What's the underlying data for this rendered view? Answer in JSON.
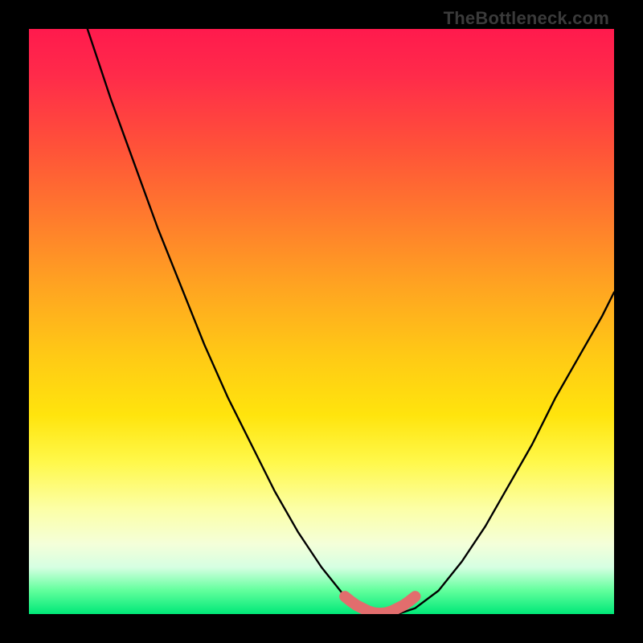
{
  "watermark": "TheBottleneck.com",
  "chart_data": {
    "type": "line",
    "title": "",
    "xlabel": "",
    "ylabel": "",
    "xlim": [
      0,
      100
    ],
    "ylim": [
      0,
      100
    ],
    "grid": false,
    "series": [
      {
        "name": "bottleneck-curve",
        "x": [
          10,
          14,
          18,
          22,
          26,
          30,
          34,
          38,
          42,
          46,
          50,
          54,
          57,
          59,
          61,
          63,
          66,
          70,
          74,
          78,
          82,
          86,
          90,
          94,
          98,
          100
        ],
        "values": [
          100,
          88,
          77,
          66,
          56,
          46,
          37,
          29,
          21,
          14,
          8,
          3,
          1,
          0,
          0,
          0,
          1,
          4,
          9,
          15,
          22,
          29,
          37,
          44,
          51,
          55
        ]
      }
    ],
    "highlight": {
      "name": "optimal-range",
      "x": [
        54,
        55,
        56,
        57,
        58,
        59,
        60,
        61,
        62,
        63,
        64,
        65,
        66
      ],
      "values": [
        3,
        2.2,
        1.5,
        1,
        0.5,
        0.2,
        0.1,
        0.2,
        0.5,
        1,
        1.5,
        2.2,
        3
      ],
      "color": "#e26d6d"
    },
    "background_gradient": {
      "top": "#ff1a4d",
      "bottom": "#00e878"
    }
  }
}
